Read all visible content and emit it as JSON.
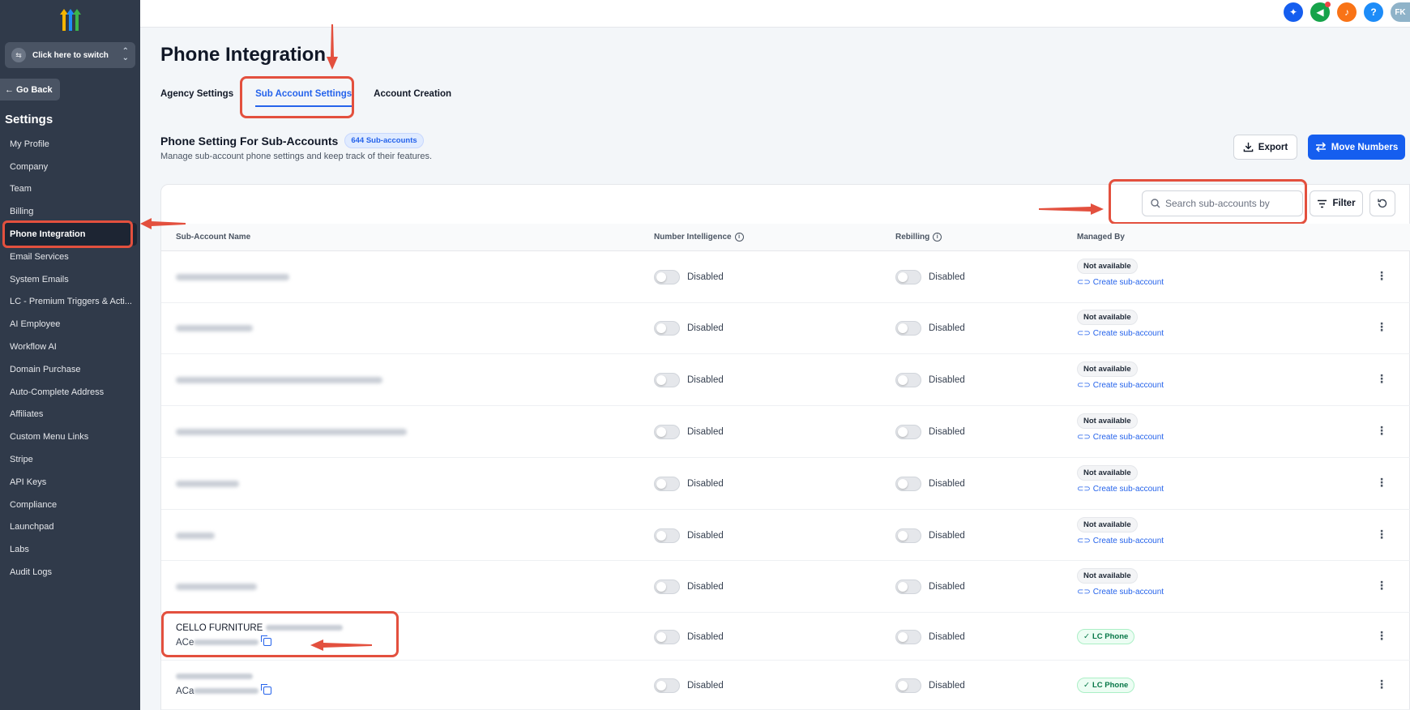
{
  "sidebar": {
    "switcher_label": "Click here to switch",
    "go_back": "Go Back",
    "title": "Settings",
    "items": [
      {
        "label": "My Profile"
      },
      {
        "label": "Company"
      },
      {
        "label": "Team"
      },
      {
        "label": "Billing"
      },
      {
        "label": "Phone Integration"
      },
      {
        "label": "Email Services"
      },
      {
        "label": "System Emails"
      },
      {
        "label": "LC - Premium Triggers & Acti..."
      },
      {
        "label": "AI Employee"
      },
      {
        "label": "Workflow AI"
      },
      {
        "label": "Domain Purchase"
      },
      {
        "label": "Auto-Complete Address"
      },
      {
        "label": "Affiliates"
      },
      {
        "label": "Custom Menu Links"
      },
      {
        "label": "Stripe"
      },
      {
        "label": "API Keys"
      },
      {
        "label": "Compliance"
      },
      {
        "label": "Launchpad"
      },
      {
        "label": "Labs"
      },
      {
        "label": "Audit Logs"
      }
    ]
  },
  "topbar": {
    "avatar_initials": "FK",
    "help_label": "?",
    "colors": {
      "magic": "#155eef",
      "announce": "#16a34a",
      "bell": "#f97316",
      "help": "#1d8cf8",
      "avatar": "#8fb3c9"
    }
  },
  "page": {
    "title": "Phone Integration",
    "tabs": [
      {
        "label": "Agency Settings"
      },
      {
        "label": "Sub Account Settings"
      },
      {
        "label": "Account Creation"
      }
    ],
    "section_title": "Phone Setting For Sub-Accounts",
    "badge": "644 Sub-accounts",
    "section_sub": "Manage sub-account phone settings and keep track of their features.",
    "export_label": "Export",
    "move_label": "Move Numbers",
    "search_placeholder": "Search sub-accounts by",
    "filter_label": "Filter"
  },
  "table": {
    "headers": {
      "name": "Sub-Account Name",
      "intelligence": "Number Intelligence",
      "rebilling": "Rebilling",
      "managed": "Managed By"
    },
    "disabled": "Disabled",
    "not_available": "Not available",
    "create_link": "Create sub-account",
    "lc_phone": "LC Phone",
    "rows": [
      {
        "name": "",
        "sid_prefix": ""
      },
      {
        "name": "",
        "sid_prefix": ""
      },
      {
        "name": "",
        "sid_prefix": ""
      },
      {
        "name": "",
        "sid_prefix": ""
      },
      {
        "name": "",
        "sid_prefix": ""
      },
      {
        "name": "",
        "sid_prefix": ""
      },
      {
        "name": "",
        "sid_prefix": ""
      },
      {
        "name": "CELLO FURNITURE",
        "sid_prefix": "ACe"
      },
      {
        "name": "",
        "sid_prefix": "ACa"
      }
    ]
  },
  "accent": "#e3503e"
}
